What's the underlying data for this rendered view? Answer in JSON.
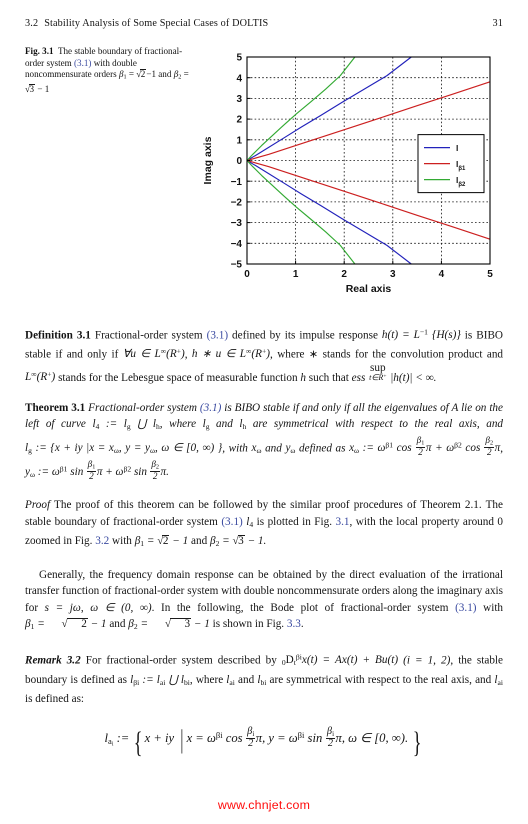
{
  "header": {
    "section_number": "3.2",
    "section_title": "Stability Analysis of Some Special Cases of DOLTIS",
    "page_number": "31"
  },
  "figure": {
    "label": "Fig. 3.1",
    "caption_part1": "The stable boundary of fractional-order system ",
    "caption_ref": "(3.1)",
    "caption_part2": " with double noncommensurate orders ",
    "caption_beta1": "β",
    "caption_beta1_sub": "1",
    "caption_eq1": " = ",
    "caption_sqrt2": "2",
    "caption_minus1": "−1",
    "caption_and": " and ",
    "caption_beta2": "β",
    "caption_beta2_sub": "2",
    "caption_eq2": " = ",
    "caption_sqrt3": "3",
    "caption_minus1b": " − 1"
  },
  "chart_data": {
    "type": "line",
    "title": "",
    "xlabel": "Real axis",
    "ylabel": "Imag axis",
    "xlim": [
      0,
      5
    ],
    "ylim": [
      -5,
      5
    ],
    "xticks": [
      0,
      1,
      2,
      3,
      4,
      5
    ],
    "yticks": [
      -5,
      -4,
      -3,
      -2,
      -1,
      0,
      1,
      2,
      3,
      4,
      5
    ],
    "grid": true,
    "grid_style": "dotted",
    "legend_position": "right-middle",
    "legend": [
      {
        "label": "l",
        "sub": "",
        "color": "#2222bb"
      },
      {
        "label": "l",
        "sub": "β1",
        "color": "#cc2020"
      },
      {
        "label": "l",
        "sub": "β2",
        "color": "#33aa33"
      }
    ],
    "series": [
      {
        "name": "l",
        "color": "#2222bb",
        "description": "curve l4: upper branch from origin to (3.38, 5) and mirrored lower branch to (3.38, -5)",
        "upper_points": [
          [
            0,
            0
          ],
          [
            0.18,
            0.25
          ],
          [
            0.45,
            0.64
          ],
          [
            0.78,
            1.12
          ],
          [
            1.12,
            1.62
          ],
          [
            1.52,
            2.18
          ],
          [
            1.95,
            2.8
          ],
          [
            2.4,
            3.43
          ],
          [
            2.88,
            4.1
          ],
          [
            3.38,
            5.0
          ]
        ],
        "lower_points": [
          [
            0,
            0
          ],
          [
            0.18,
            -0.25
          ],
          [
            0.45,
            -0.64
          ],
          [
            0.78,
            -1.12
          ],
          [
            1.12,
            -1.62
          ],
          [
            1.52,
            -2.18
          ],
          [
            1.95,
            -2.8
          ],
          [
            2.4,
            -3.43
          ],
          [
            2.88,
            -4.1
          ],
          [
            3.38,
            -5.0
          ]
        ]
      },
      {
        "name": "l_beta1",
        "color": "#cc2020",
        "description": "curve l_beta1: upper branch from origin to (5, 3.8) and mirrored lower branch to (5, -3.8)",
        "upper_points": [
          [
            0,
            0
          ],
          [
            0.45,
            0.3
          ],
          [
            1.0,
            0.72
          ],
          [
            1.6,
            1.18
          ],
          [
            2.2,
            1.64
          ],
          [
            2.85,
            2.14
          ],
          [
            3.5,
            2.65
          ],
          [
            4.2,
            3.18
          ],
          [
            5.0,
            3.8
          ]
        ],
        "lower_points": [
          [
            0,
            0
          ],
          [
            0.45,
            -0.3
          ],
          [
            1.0,
            -0.72
          ],
          [
            1.6,
            -1.18
          ],
          [
            2.2,
            -1.64
          ],
          [
            2.85,
            -2.14
          ],
          [
            3.5,
            -2.65
          ],
          [
            4.2,
            -3.18
          ],
          [
            5.0,
            -3.8
          ]
        ]
      },
      {
        "name": "l_beta2",
        "color": "#33aa33",
        "description": "curve l_beta2: upper branch from origin to (2.22, 5) and mirrored lower branch to (2.22, -5)",
        "upper_points": [
          [
            0,
            0
          ],
          [
            0.12,
            0.3
          ],
          [
            0.3,
            0.72
          ],
          [
            0.52,
            1.2
          ],
          [
            0.76,
            1.72
          ],
          [
            1.02,
            2.26
          ],
          [
            1.32,
            2.85
          ],
          [
            1.62,
            3.45
          ],
          [
            1.92,
            4.1
          ],
          [
            2.22,
            5.0
          ]
        ],
        "lower_points": [
          [
            0,
            0
          ],
          [
            0.12,
            -0.3
          ],
          [
            0.3,
            -0.72
          ],
          [
            0.52,
            -1.2
          ],
          [
            0.76,
            -1.72
          ],
          [
            1.02,
            -2.26
          ],
          [
            1.32,
            -2.85
          ],
          [
            1.62,
            -3.45
          ],
          [
            1.92,
            -4.1
          ],
          [
            2.22,
            -5.0
          ]
        ]
      }
    ]
  },
  "definition": {
    "label": "Definition 3.1",
    "t1": " Fractional-order system ",
    "ref": "(3.1)",
    "t2": " defined by its impulse response ",
    "t3": " is BIBO stable if and only if ",
    "t4": ", where ∗ stands for the convolution product and ",
    "t5": " stands for the Lebesgue space of measurable function ",
    "t6": " such that ",
    "esssup_top": "sup",
    "esssup_bot": "t∈R",
    "ess_word": "ess"
  },
  "theorem": {
    "label": "Theorem 3.1",
    "t1": " Fractional-order system ",
    "ref": "(3.1)",
    "t2": " is BIBO stable if and only if all the eigenvalues of A lie on the left of curve ",
    "t3": ", where ",
    "t4": " are symmetrical with respect to the real axis, and ",
    "t5": ", with ",
    "t6": " defined as "
  },
  "proof": {
    "label": "Proof",
    "t1": " The proof of this theorem can be followed by the similar proof procedures of Theorem 2.1. The stable boundary of fractional-order system ",
    "ref1": "(3.1)",
    "t2": " is plotted in Fig.",
    "ref2": "3.1",
    "t3": ", with the local property around 0 zoomed in Fig.",
    "ref3": "3.2",
    "t4": " with "
  },
  "general_para": {
    "t1": "Generally, the frequency domain response can be obtained by the direct evaluation of the irrational transfer function of fractional-order system with double noncommensurate orders along the imaginary axis for ",
    "t2": ". In the following, the Bode plot of fractional-order system ",
    "ref1": "(3.1)",
    "t3": " with ",
    "t4": " is shown in Fig.",
    "ref2": "3.3",
    "t5": "."
  },
  "remark": {
    "label": "Remark 3.2",
    "t1": " For fractional-order system described by ",
    "t2": ", the stable boundary is defined as ",
    "t3": ", where ",
    "t4": " are symmetrical with respect to the real axis, and ",
    "t5": " is defined as:"
  },
  "watermark": {
    "text": "www.chnjet.com",
    "color": "#ff0c0c"
  }
}
